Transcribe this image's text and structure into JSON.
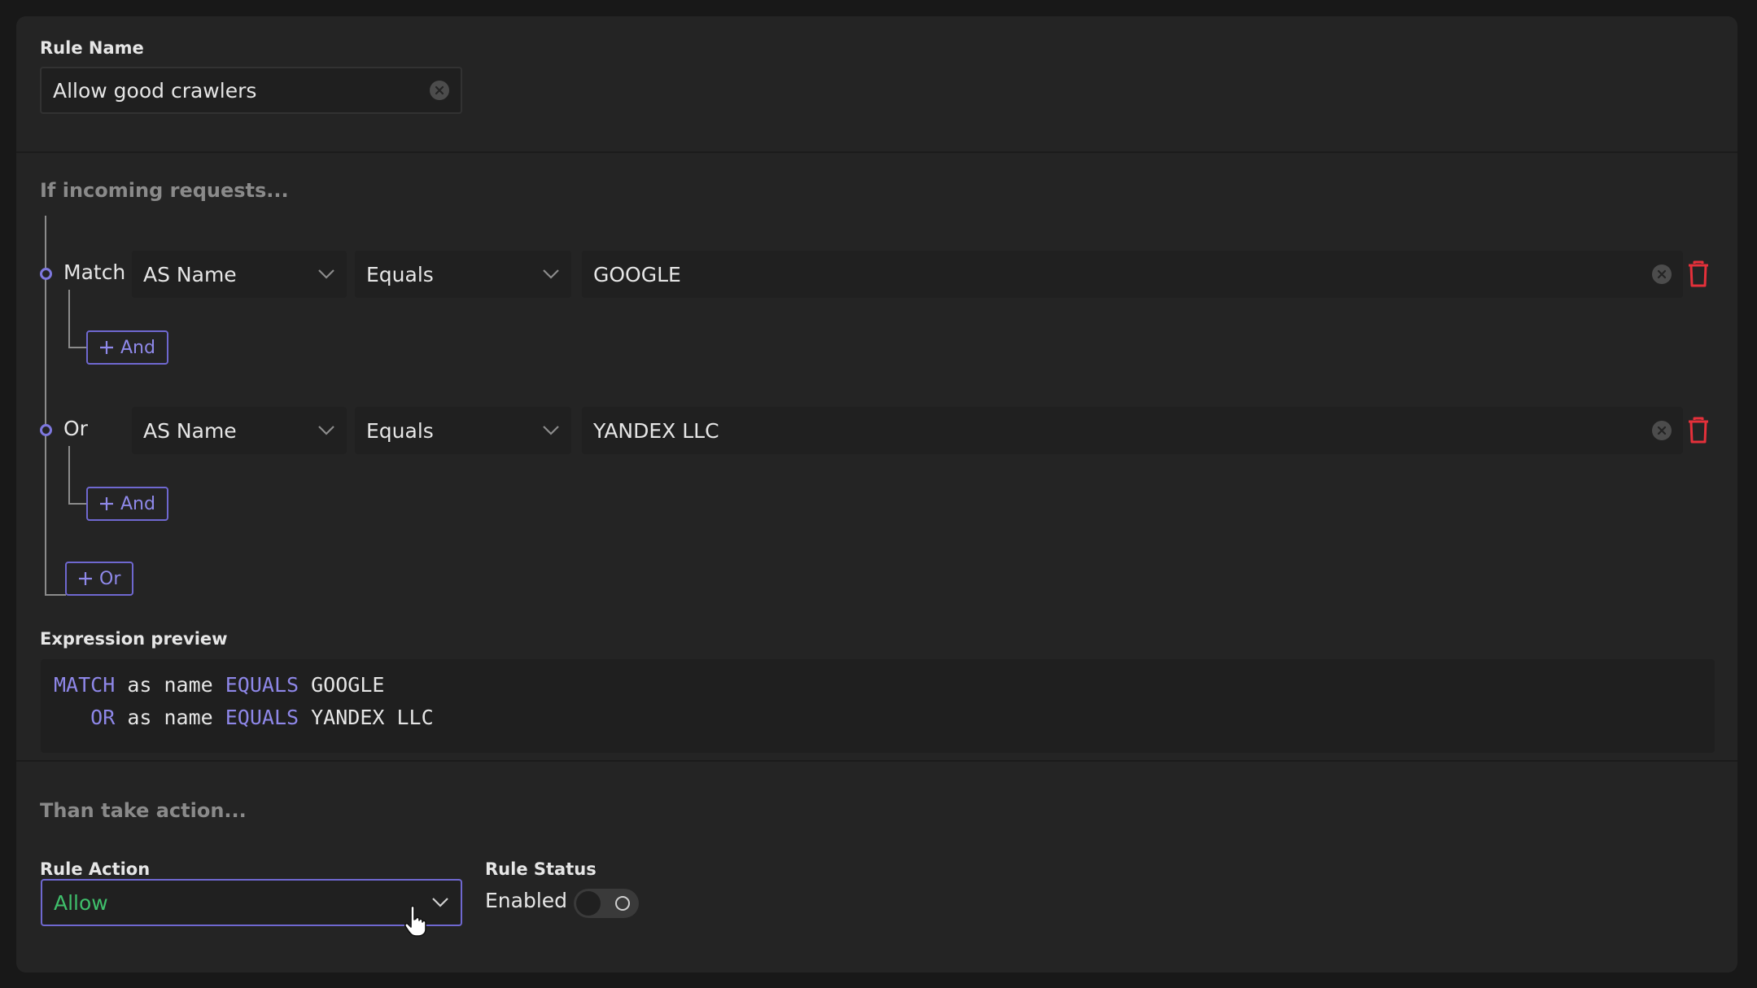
{
  "rule_name": {
    "label": "Rule Name",
    "value": "Allow good crawlers"
  },
  "conditions_section": {
    "heading": "If incoming requests..."
  },
  "conditions": [
    {
      "keyword": "Match",
      "field": "AS Name",
      "operator": "Equals",
      "value": "GOOGLE",
      "add_and_label": "And"
    },
    {
      "keyword": "Or",
      "field": "AS Name",
      "operator": "Equals",
      "value": "YANDEX LLC",
      "add_and_label": "And"
    }
  ],
  "add_or_label": "Or",
  "expression_preview": {
    "label": "Expression preview",
    "lines": [
      {
        "keyword": "MATCH",
        "field": "as name",
        "operator": "EQUALS",
        "value": "GOOGLE"
      },
      {
        "keyword": "OR",
        "field": "as name",
        "operator": "EQUALS",
        "value": "YANDEX LLC"
      }
    ]
  },
  "action_section": {
    "heading": "Than take action..."
  },
  "rule_action": {
    "label": "Rule Action",
    "value": "Allow"
  },
  "rule_status": {
    "label": "Rule Status",
    "value": "Enabled",
    "enabled": false
  },
  "colors": {
    "accent": "#7e78de",
    "danger": "#e5303a",
    "success": "#3fbf6b",
    "background": "#242424"
  },
  "icons": [
    "clear-icon",
    "chevron-down-icon",
    "trash-icon",
    "plus-icon",
    "pointer-cursor-icon"
  ]
}
